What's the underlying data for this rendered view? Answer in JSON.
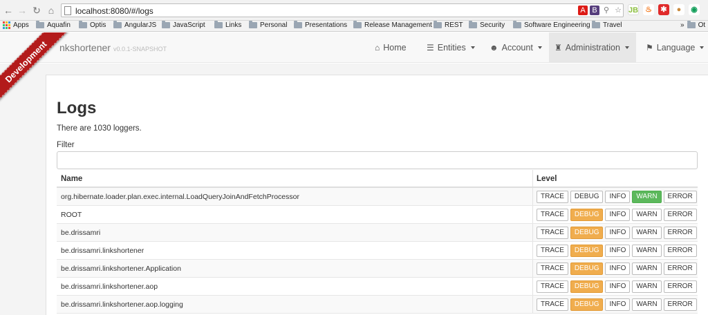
{
  "browser": {
    "url": "localhost:8080/#/logs",
    "bookmarks": [
      "Apps",
      "Aquafin",
      "Optis",
      "AngularJS",
      "JavaScript",
      "Links",
      "Personal",
      "Presentations",
      "Release Management",
      "REST",
      "Security",
      "Software Engineering",
      "Travel"
    ],
    "overflow": "»",
    "overflow_label": "Ot"
  },
  "ribbon": "Development",
  "navbar": {
    "brand": "nkshortener",
    "version": "v0.0.1-SNAPSHOT",
    "items": [
      {
        "label": "Home",
        "icon": "home-icon"
      },
      {
        "label": "Entities",
        "icon": "list-icon"
      },
      {
        "label": "Account",
        "icon": "user-icon"
      },
      {
        "label": "Administration",
        "icon": "tower-icon"
      },
      {
        "label": "Language",
        "icon": "flag-icon"
      }
    ]
  },
  "page": {
    "title": "Logs",
    "count_text": "There are 1030 loggers.",
    "filter_label": "Filter",
    "filter_value": ""
  },
  "table": {
    "headers": [
      "Name",
      "Level"
    ],
    "level_labels": [
      "TRACE",
      "DEBUG",
      "INFO",
      "WARN",
      "ERROR"
    ],
    "rows": [
      {
        "name": "org.hibernate.loader.plan.exec.internal.LoadQueryJoinAndFetchProcessor",
        "level": "WARN"
      },
      {
        "name": "ROOT",
        "level": "DEBUG"
      },
      {
        "name": "be.drissamri",
        "level": "DEBUG"
      },
      {
        "name": "be.drissamri.linkshortener",
        "level": "DEBUG"
      },
      {
        "name": "be.drissamri.linkshortener.Application",
        "level": "DEBUG"
      },
      {
        "name": "be.drissamri.linkshortener.aop",
        "level": "DEBUG"
      },
      {
        "name": "be.drissamri.linkshortener.aop.logging",
        "level": "DEBUG"
      }
    ]
  },
  "colors": {
    "ribbon": "#b31b1b",
    "debug_active": "#f0ad4e",
    "warn_active": "#5cb85c"
  }
}
